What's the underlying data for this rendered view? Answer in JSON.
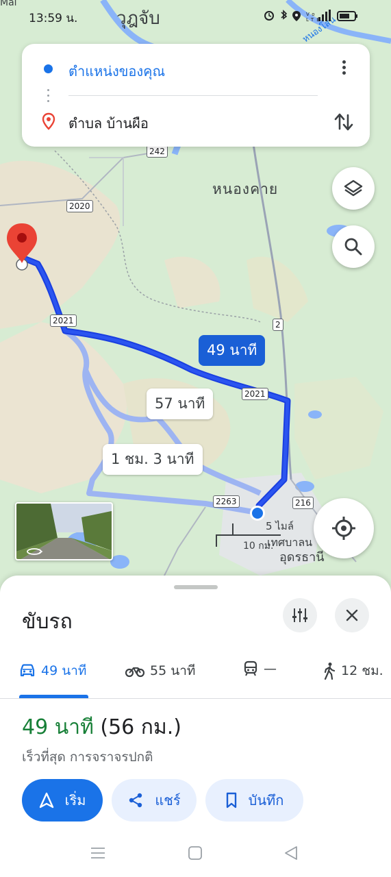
{
  "status_bar": {
    "time": "13:59 น.",
    "icons": [
      "alarm-icon",
      "bluetooth-icon",
      "location-icon",
      "volte-icon",
      "signal-icon",
      "battery-icon"
    ]
  },
  "search_card": {
    "origin": "ตำแหน่งของคุณ",
    "destination": "ตำบล บ้านผือ"
  },
  "map": {
    "labels": {
      "city_top": "วุฎจับ",
      "city_north_right": "หนองคาย",
      "district_bottom": "อุดรธานี",
      "municipality": "เทศบาลน",
      "top_left_fragment": "Mai",
      "top_right_fragment": "หนองโสน"
    },
    "roads": [
      "242",
      "2020",
      "2021",
      "2",
      "2021",
      "2263",
      "216"
    ],
    "scale": {
      "miles": "5 ไมล์",
      "km": "10 กม."
    },
    "routes": {
      "primary": "49 นาที",
      "alt1": "57 นาที",
      "alt2": "1 ชม. 3 นาที"
    }
  },
  "sheet": {
    "title": "ขับรถ",
    "modes": [
      {
        "icon": "car-icon",
        "label": "49 นาที"
      },
      {
        "icon": "motorcycle-icon",
        "label": "55 นาที"
      },
      {
        "icon": "transit-icon",
        "label": "—"
      },
      {
        "icon": "walk-icon",
        "label": "12 ชม."
      }
    ],
    "duration": "49 นาที",
    "distance": "(56 กม.)",
    "description": "เร็วที่สุด การจราจรปกติ",
    "actions": {
      "start": "เริ่ม",
      "share": "แชร์",
      "save": "บันทึก"
    }
  },
  "colors": {
    "accent": "#1a73e8",
    "route_primary": "#1a3fe0",
    "route_alt": "#9db4f2",
    "duration_green": "#188038",
    "map_green": "#d7ecd3",
    "destination_red": "#ea4335"
  }
}
